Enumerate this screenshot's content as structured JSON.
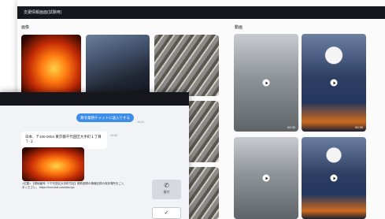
{
  "window": {
    "title": "支援情報画面(試験用)"
  },
  "sections": {
    "images_label": "画像",
    "videos_label": "動画"
  },
  "videos": [
    {
      "duration": "00:30"
    },
    {
      "duration": "00:30"
    },
    {
      "duration": ""
    },
    {
      "duration": ""
    }
  ],
  "chat": {
    "send_button_label": "救令業務チャットに送入りする",
    "send_time": "10:24",
    "address_text": "日本、〒100-0004 東京都千代田区大手町１丁目７-２",
    "address_time": "10:33",
    "note_text": "<位置>\n【現地番号: 〒千代田区大手町付近】救助部隊の情報記録の保存場所をご入手ください。\nhttps://xxxx.leaf.com/abc/xyz",
    "side_button_label": "接付",
    "side_button_icon": "phone-icon",
    "check_icon": "checkmark-icon"
  }
}
